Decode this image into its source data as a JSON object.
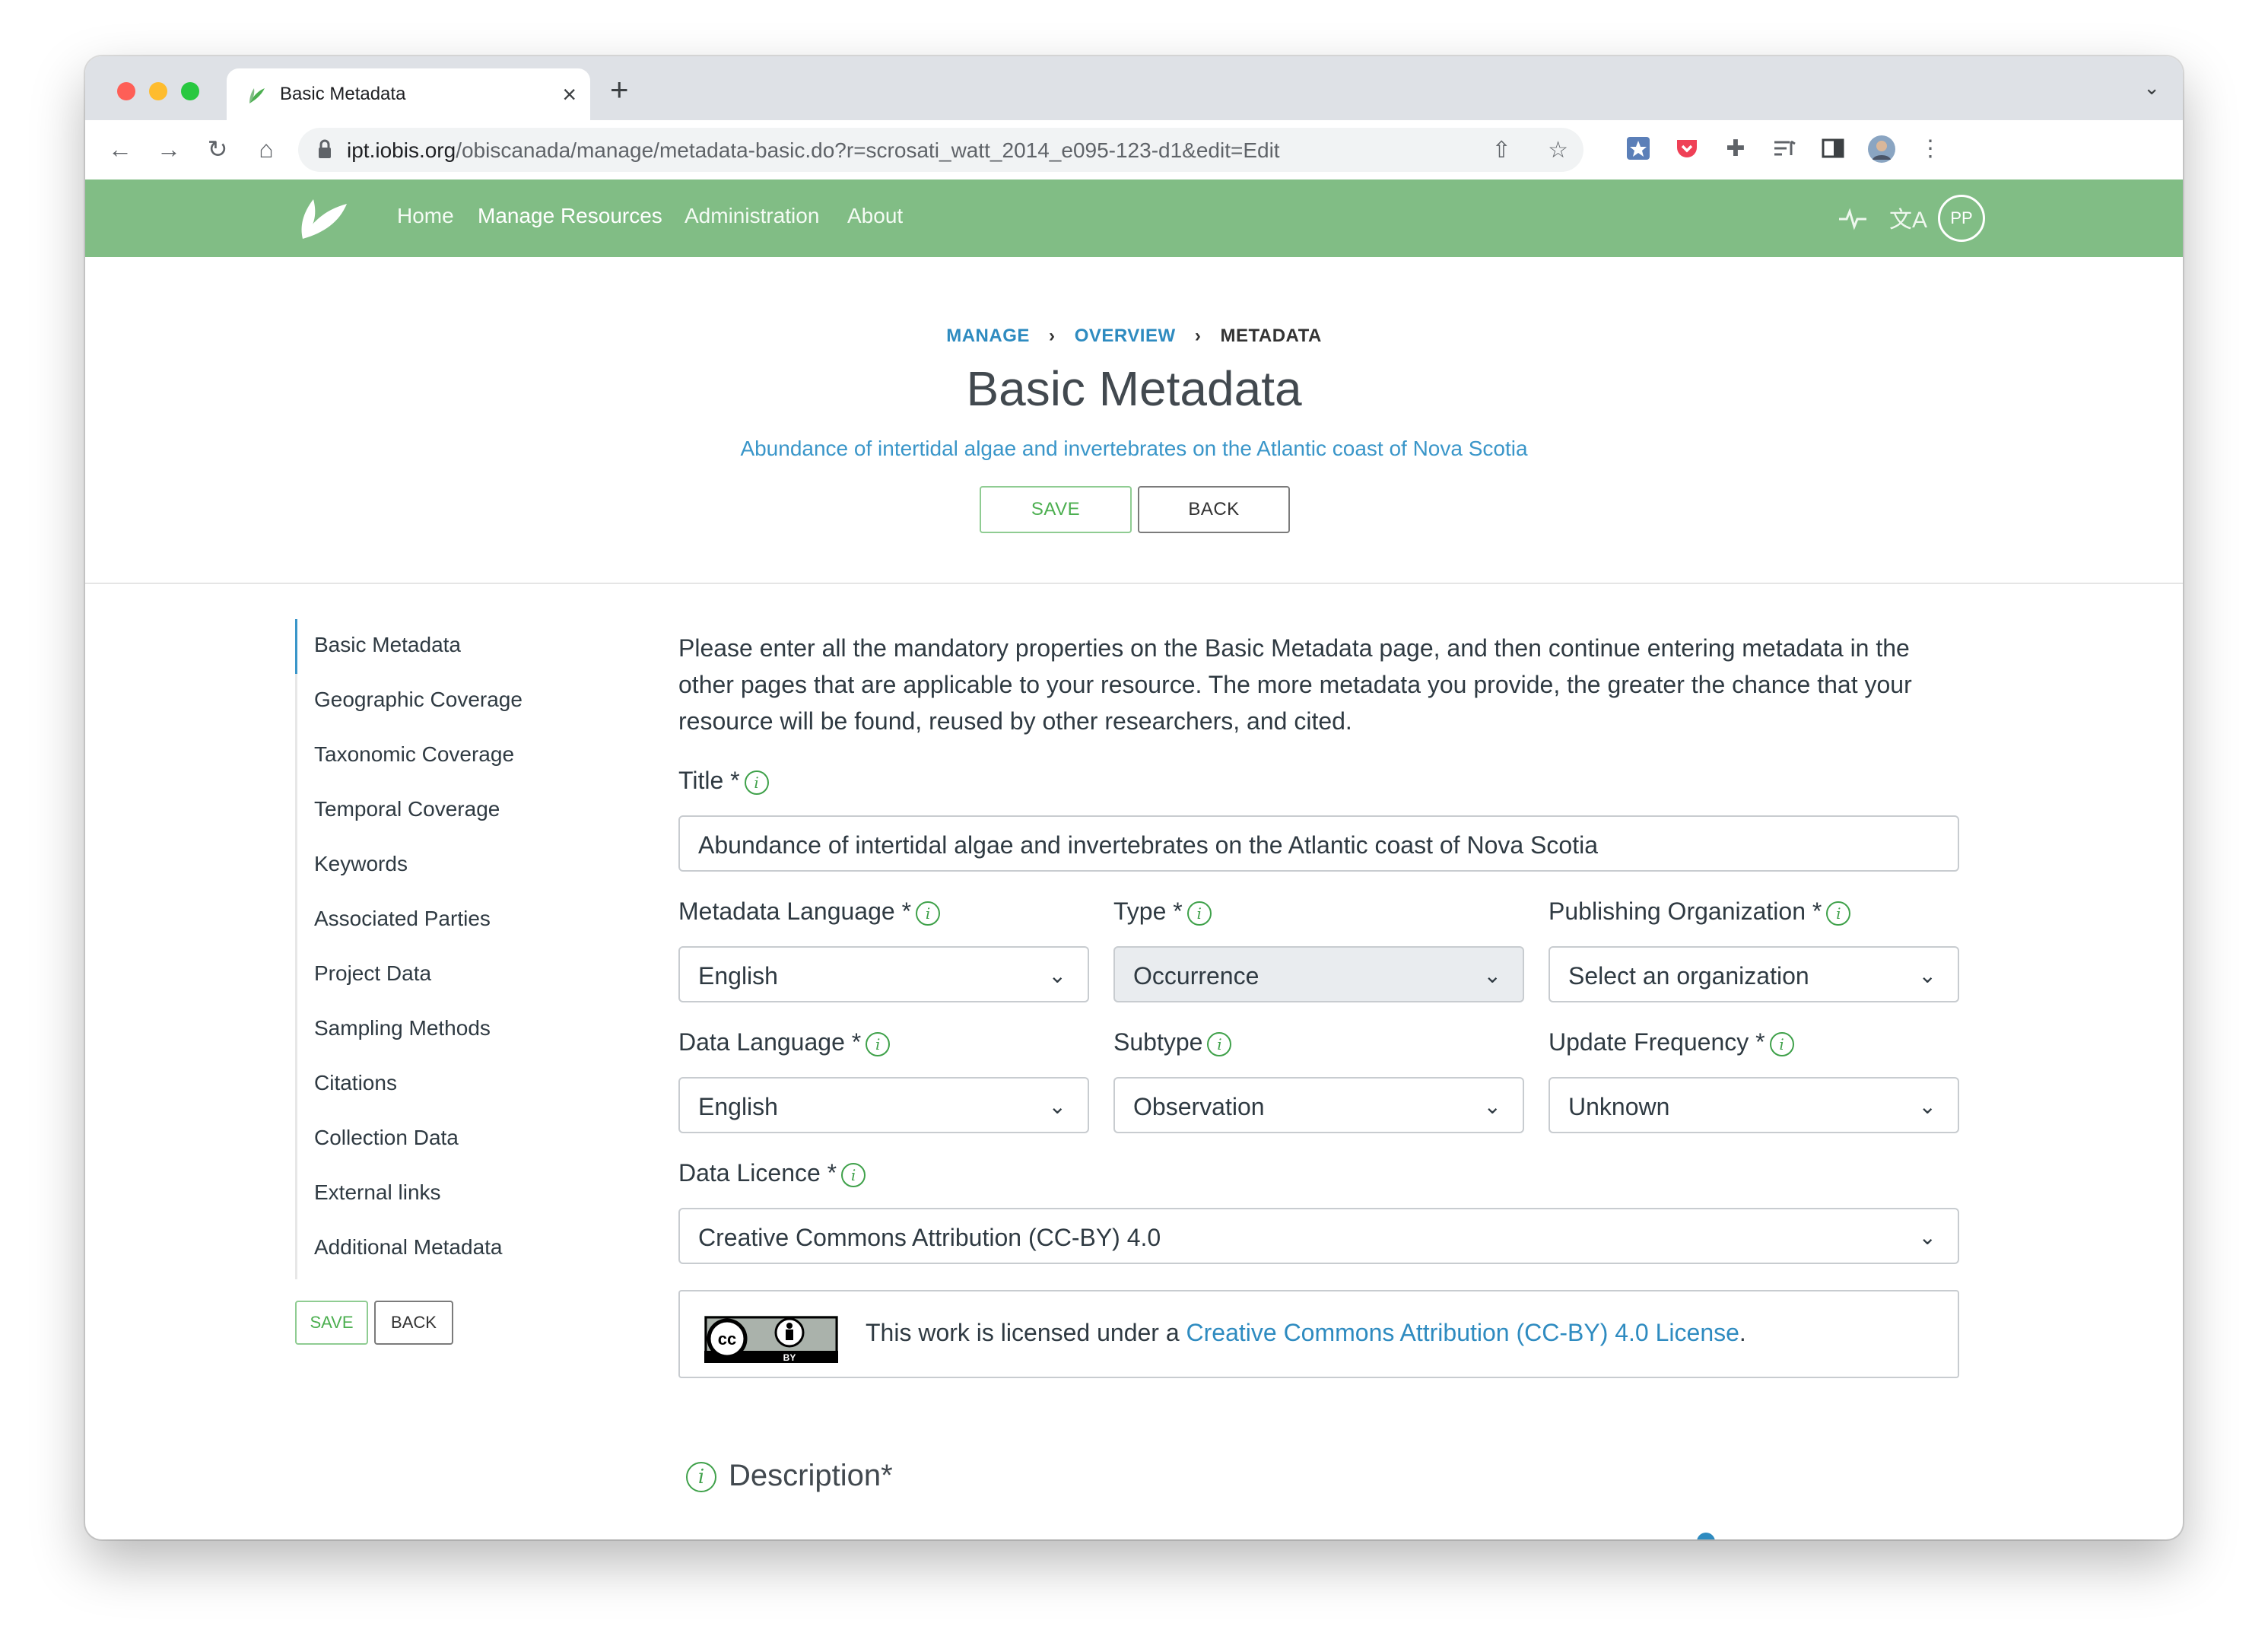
{
  "browser": {
    "tab_title": "Basic Metadata",
    "tab_close": "×",
    "new_tab": "+",
    "tab_menu": "⌄",
    "url_host": "ipt.iobis.org",
    "url_path": "/obiscanada/manage/metadata-basic.do?r=scrosati_watt_2014_e095-123-d1&edit=Edit",
    "nav": {
      "back": "←",
      "forward": "→",
      "reload": "↻",
      "home": "⌂"
    },
    "icons": {
      "share": "⇧",
      "bookmark": "☆",
      "extensions": "✚",
      "menu": "⋮"
    }
  },
  "appbar": {
    "nav_items": [
      "Home",
      "Manage Resources",
      "Administration",
      "About"
    ],
    "active_item": "Manage Resources",
    "activity_icon": "⁓",
    "language_icon": "文A",
    "avatar_initials": "PP",
    "color": "#81bd85"
  },
  "header": {
    "breadcrumb": [
      "MANAGE",
      "OVERVIEW",
      "METADATA"
    ],
    "breadcrumb_sep": "›",
    "title": "Basic Metadata",
    "subtitle": "Abundance of intertidal algae and invertebrates on the Atlantic coast of Nova Scotia",
    "save_label": "SAVE",
    "back_label": "BACK"
  },
  "sidenav": {
    "items": [
      "Basic Metadata",
      "Geographic Coverage",
      "Taxonomic Coverage",
      "Temporal Coverage",
      "Keywords",
      "Associated Parties",
      "Project Data",
      "Sampling Methods",
      "Citations",
      "Collection Data",
      "External links",
      "Additional Metadata"
    ],
    "active_index": 0,
    "save_label": "SAVE",
    "back_label": "BACK"
  },
  "form": {
    "intro": "Please enter all the mandatory properties on the Basic Metadata page, and then continue entering metadata in the other pages that are applicable to your resource. The more metadata you provide, the greater the chance that your resource will be found, reused by other researchers, and cited.",
    "info_glyph": "i",
    "chevron": "⌄",
    "title_label": "Title *",
    "title_value": "Abundance of intertidal algae and invertebrates on the Atlantic coast of Nova Scotia",
    "metadata_language_label": "Metadata Language *",
    "metadata_language_value": "English",
    "type_label": "Type *",
    "type_value": "Occurrence",
    "publishing_org_label": "Publishing Organization *",
    "publishing_org_value": "Select an organization",
    "data_language_label": "Data Language *",
    "data_language_value": "English",
    "subtype_label": "Subtype",
    "subtype_value": "Observation",
    "update_frequency_label": "Update Frequency *",
    "update_frequency_value": "Unknown",
    "data_licence_label": "Data Licence *",
    "data_licence_value": "Creative Commons Attribution (CC-BY) 4.0",
    "licence_text_prefix": "This work is licensed under a ",
    "licence_link": "Creative Commons Attribution (CC-BY) 4.0 License",
    "licence_text_suffix": ".",
    "cc_badge": {
      "cc": "cc",
      "by": "BY"
    },
    "description_heading": "Description*"
  },
  "colors": {
    "accent_link": "#2e8bc0",
    "green": "#4caf50",
    "text": "#2f3a42"
  }
}
